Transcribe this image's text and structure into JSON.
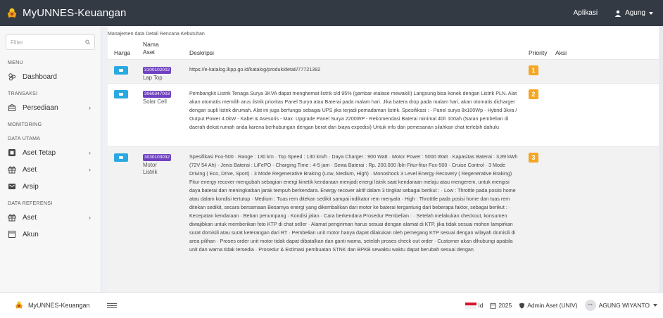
{
  "topbar": {
    "title": "MyUNNES-Keuangan",
    "apps": "Aplikasi",
    "user": "Agung"
  },
  "sidebar": {
    "filter_placeholder": "Filter",
    "sections": {
      "menu": "MENU",
      "transaksi": "TRANSAKSI",
      "monitoring": "MONITORING",
      "data_utama": "DATA UTAMA",
      "data_referensi": "DATA REFERENSI"
    },
    "items": {
      "dashboard": "Dashboard",
      "persediaan": "Persediaan",
      "aset_tetap": "Aset Tetap",
      "aset": "Aset",
      "arsip": "Arsip",
      "aset_ref": "Aset",
      "akun": "Akun"
    }
  },
  "main": {
    "breadcrumb": "Manajemen data Detail Rencana Kebutuhan",
    "columns": {
      "harga": "Harga",
      "nama": "Nama\nAset",
      "desc": "Deskripsi",
      "priority": "Priority",
      "aksi": "Aksi"
    },
    "rows": [
      {
        "code": "3100102002",
        "name": "Lap Top",
        "priority": "1",
        "desc": "https://e-katalog.lkpp.go.id/katalog/produk/detail/77721392"
      },
      {
        "code": "3060347003",
        "name": "Solar Cell",
        "priority": "2",
        "desc": "Pembangkit Listrik Tenaga Surya 3KVA dapat menghemat listrik s/d 95% (gambar etalase mewakili) Langsung bisa konek dengan Listrik PLN. Alat akan otomatis memilih arus listrik prioritas Panel Surya atau Baterai pada malam hari. Jika batera drop pada malam hari, akan otomatis dicharger dengan supli listrik dirumah. Alat ini juga berfungsi sebagai UPS jika terjadi pemadaman listrik. Spesifikasi : - Panel surya 8x100Wp - Hybrid 3kva / Output Power 4.0kW - Kabel & Asesoris - Max. Upgrade Panel Surya 2200WP - Rekomendasi Baterai minimal 4bh 100ah (Saran pembelian di daerah dekat rumah anda karena berhubungan dengan berat dan biaya expedisi) Untuk info dan pemesanan silahkan chat terlebih dahulu"
      },
      {
        "code": "3030103032",
        "name": "Motor Listrik",
        "priority": "3",
        "desc": "Spesifikasi Fox-500 · Range : 130 km · Top Speed : 130 km/h · Daya Charger : 900 Watt · Motor Power : 5000 Watt · Kapasitas Baterai : 3,89 kWh (72V 54 Ah) · Jenis Baterai : LiFePO · Charging Time : 4-5 jam · Sewa Baterai : Rp. 200.000 /bln Fitur-fitur Fox-500 · Cruise Control · 3 Mode Driving ( Eco, Drive, Sport) · 3 Mode Regenerative Braking (Low, Medium, High) · Monoshock 3 Level Energy Recovery ( Regenerative Braking) Fitur energy recover mengubah sebagian energi kinetik kendaraan menjadi energi listrik saat kendaraan melaju atau mengerem, untuk mengisi daya baterai dan meningkatkan jarak tempuh berkendara. Energy recover aktif dalam 3 tingkat sebagai berikut : · Low : Throttle pada posisi home atau dalam kondisi tertutup · Medium : Tuas rem ditekan sedikit sampai indikator rem menyala · High : Throtttle pada posisi home dan tuas rem ditekan sedikit, secara bersamaan Besarnya energi yang dikembalikan dari motor ke baterai tergantung dari beberapa faktor, sebagai berikut : · Kecepatan kendaraan · Beban penumpang · Kondisi jalan · Cara berkendara Prosedur Pembelian : · Setelah melakukan checkout, konsumen diwajibkan untuk memberikan foto KTP di chat seller · Alamat pengiriman harus sesuai dengan alamat di KTP, jika tidak sesuai mohon lampirkan surat domisili atau surat keterangan dari RT · Pembelian unit motor hanya dapat dilakukan oleh pemegang KTP sesuai dengan wilayah domisili di area pilihan · Proses order unit motor tidak dapat dibatalkan dan ganti warna, setelah proses check out order · Customer akan dihubungi apabila unit dan warna tidak tersedia · Prosedur & Estimasi pembuatan STNK dan BPKB sewaktu waktu dapat berubah sesuai dengan"
      }
    ]
  },
  "bottombar": {
    "brand": "MyUNNES-Keuangan",
    "lang": "id",
    "year": "2025",
    "role": "Admin Aset (UNIV)",
    "user": "AGUNG WIYANTO"
  },
  "colors": {
    "topbar": "#333a44",
    "accent": "#2ba9e1",
    "code_badge": "#6f42c1",
    "priority": "#f5a623",
    "flag_red": "#d8142a"
  }
}
